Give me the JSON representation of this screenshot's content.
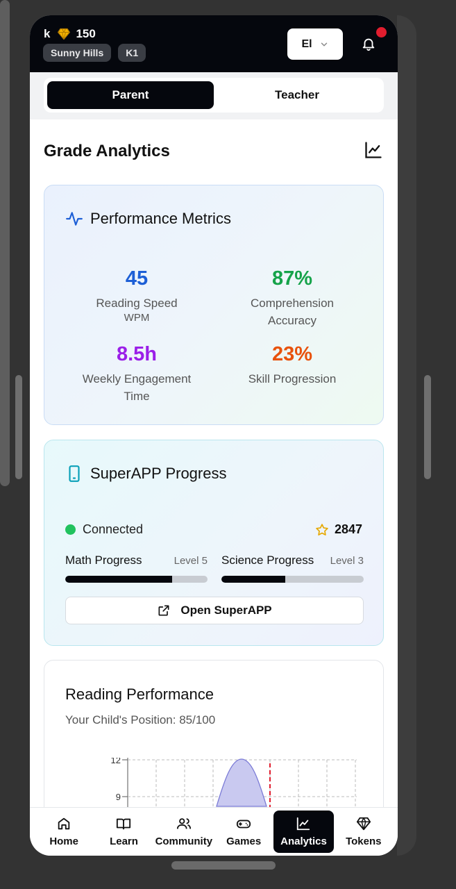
{
  "header": {
    "user_initial": "k",
    "token_count": "150",
    "school": "Sunny Hills",
    "grade": "K1",
    "language": "El"
  },
  "role_toggle": {
    "parent": "Parent",
    "teacher": "Teacher",
    "active": "Parent"
  },
  "page": {
    "title": "Grade Analytics"
  },
  "metrics": {
    "title": "Performance Metrics",
    "items": [
      {
        "value": "45",
        "label": "Reading Speed",
        "unit": "WPM",
        "color": "#1d5fd6"
      },
      {
        "value": "87%",
        "label": "Comprehension Accuracy",
        "unit": "",
        "color": "#16a34a"
      },
      {
        "value": "8.5h",
        "label": "Weekly Engagement Time",
        "unit": "",
        "color": "#9b1fe8"
      },
      {
        "value": "23%",
        "label": "Skill Progression",
        "unit": "",
        "color": "#e8520c"
      }
    ]
  },
  "superapp": {
    "title": "SuperAPP Progress",
    "status": "Connected",
    "points": "2847",
    "progress": [
      {
        "name": "Math Progress",
        "level": "Level 5",
        "fraction": 0.75
      },
      {
        "name": "Science Progress",
        "level": "Level 3",
        "fraction": 0.45
      }
    ],
    "open_label": "Open SuperAPP"
  },
  "reading": {
    "title": "Reading Performance",
    "subtitle": "Your Child's Position: 85/100",
    "y_ticks": [
      "12",
      "9"
    ]
  },
  "nav": [
    {
      "label": "Home",
      "icon": "home-icon"
    },
    {
      "label": "Learn",
      "icon": "book-icon"
    },
    {
      "label": "Community",
      "icon": "users-icon"
    },
    {
      "label": "Games",
      "icon": "gamepad-icon"
    },
    {
      "label": "Analytics",
      "icon": "analytics-icon",
      "active": true
    },
    {
      "label": "Tokens",
      "icon": "gem-icon"
    }
  ],
  "colors": {
    "accent_dark": "#05070d",
    "notification": "#e11d2e",
    "connected": "#21c25e",
    "star": "#e6a800"
  }
}
